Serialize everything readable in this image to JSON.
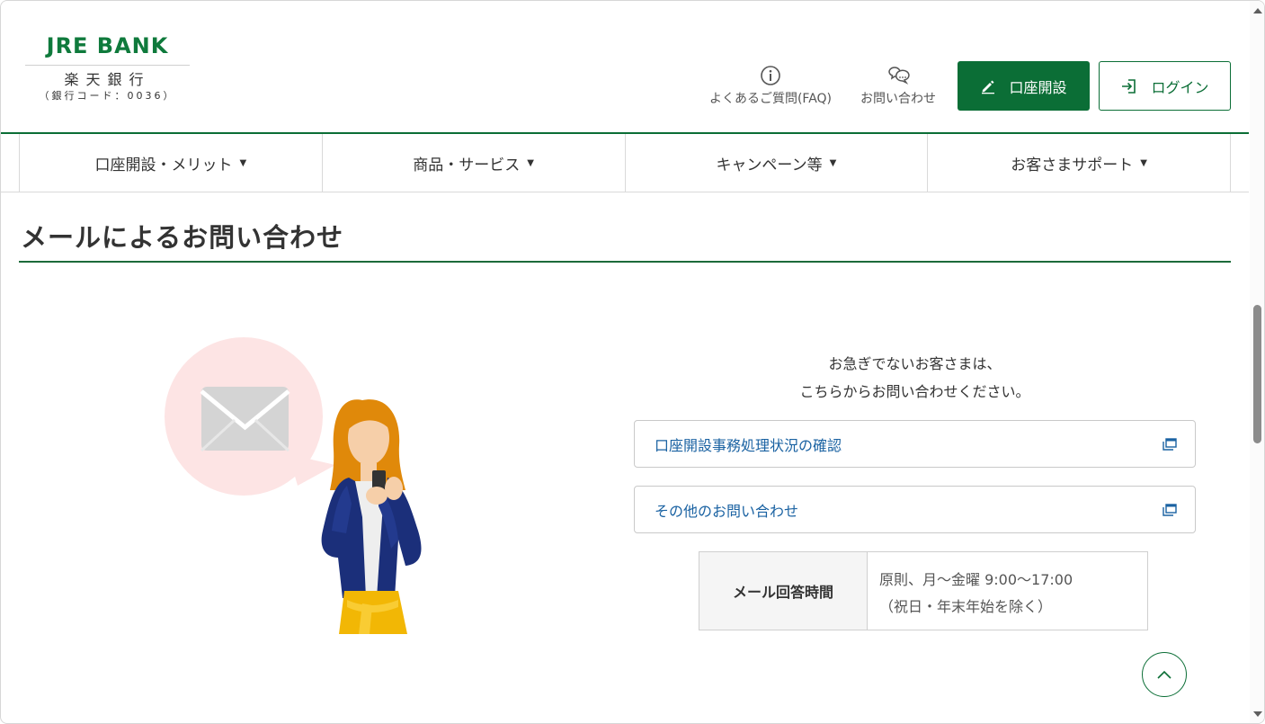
{
  "logo": {
    "en": "JRE BANK",
    "jp": "楽天銀行",
    "code": "（銀行コード：0036）"
  },
  "header": {
    "faq_label": "よくあるご質問(FAQ)",
    "contact_label": "お問い合わせ",
    "open_account_label": "口座開設",
    "login_label": "ログイン"
  },
  "nav": {
    "items": [
      {
        "label": "口座開設・メリット"
      },
      {
        "label": "商品・サービス"
      },
      {
        "label": "キャンペーン等"
      },
      {
        "label": "お客さまサポート"
      }
    ]
  },
  "main": {
    "title": "メールによるお問い合わせ",
    "intro_line1": "お急ぎでないお客さまは、",
    "intro_line2": "こちらからお問い合わせください。",
    "links": [
      {
        "label": "口座開設事務処理状況の確認"
      },
      {
        "label": "その他のお問い合わせ"
      }
    ],
    "hours": {
      "header": "メール回答時間",
      "line1": "原則、月～金曜 9:00～17:00",
      "line2": "（祝日・年末年始を除く）"
    }
  },
  "colors": {
    "brand_green": "#0b6e36",
    "link_blue": "#1a62a2",
    "bubble_pink": "#fde4e4"
  },
  "icons": {
    "faq": "info-circle-icon",
    "contact": "chat-bubbles-icon",
    "open_account": "pencil-icon",
    "login": "login-arrow-icon",
    "external": "external-window-icon",
    "to_top": "chevron-up-icon"
  }
}
